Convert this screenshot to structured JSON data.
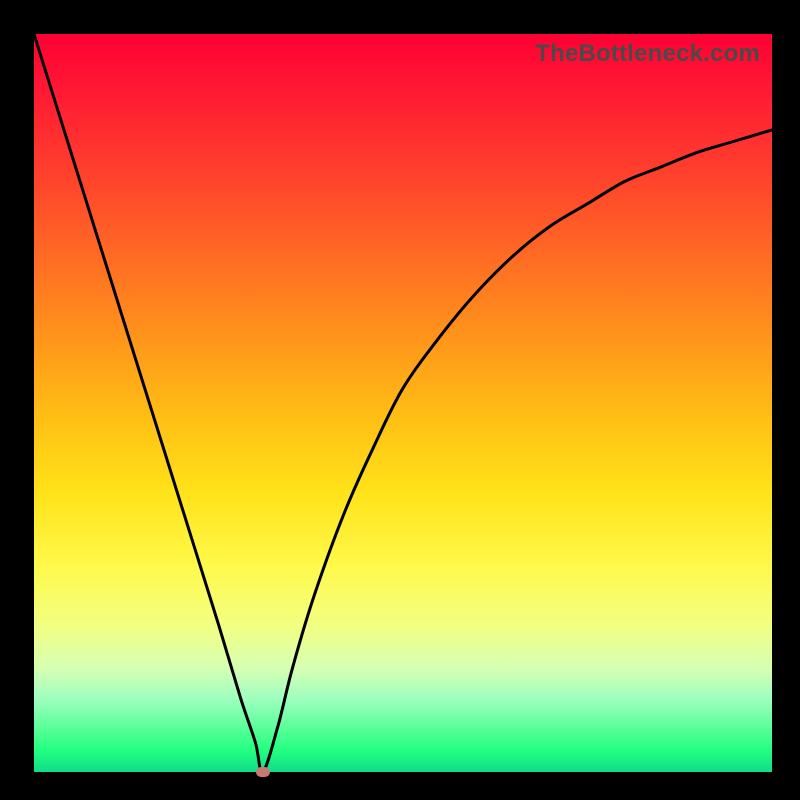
{
  "watermark": "TheBottleneck.com",
  "colors": {
    "frame": "#000000",
    "curve": "#000000",
    "marker": "#c77a74"
  },
  "chart_data": {
    "type": "line",
    "title": "",
    "xlabel": "",
    "ylabel": "",
    "xlim": [
      0,
      100
    ],
    "ylim": [
      0,
      100
    ],
    "grid": false,
    "legend": false,
    "x": [
      0,
      5,
      10,
      15,
      20,
      25,
      28,
      30,
      31,
      33,
      35,
      38,
      42,
      46,
      50,
      55,
      60,
      65,
      70,
      75,
      80,
      85,
      90,
      95,
      100
    ],
    "values": [
      100,
      84,
      68,
      52,
      36,
      20,
      10,
      4,
      0,
      6,
      14,
      24,
      35,
      44,
      52,
      59,
      65,
      70,
      74,
      77,
      80,
      82,
      84,
      85.5,
      87
    ],
    "marker": {
      "x": 31,
      "y": 0
    },
    "notes": "Background is a vertical gradient: red at top (high value) through orange/yellow to green at bottom (low value). Curve is a black V-shaped line dipping to ~0 at x≈31 then rising with decreasing slope to the right. A small salmon oval marker sits at the minimum."
  }
}
